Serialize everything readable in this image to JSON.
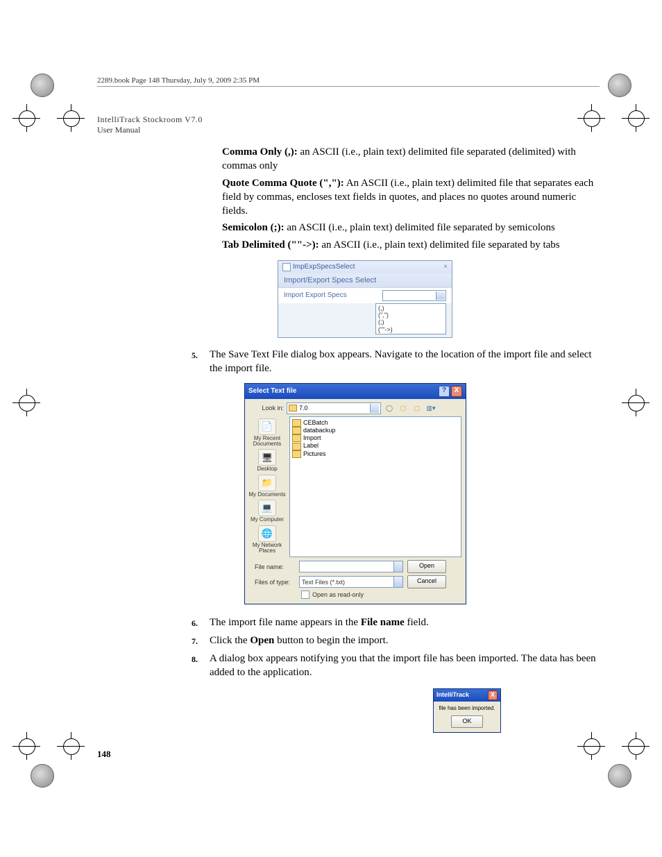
{
  "header": "2289.book  Page 148  Thursday, July 9, 2009  2:35 PM",
  "doc_title_caps": "IntelliTrack Stockroom V7.0",
  "doc_subtitle": "User Manual",
  "defs": {
    "comma_term": "Comma Only (,):",
    "comma_text": " an ASCII (i.e., plain text) delimited file separated (delimited) with commas only",
    "quote_term": "Quote Comma Quote (\",\"):",
    "quote_text": " An ASCII (i.e., plain text) delimited file that separates each field by commas, encloses text fields in quotes, and places no quotes around numeric fields.",
    "semi_term": "Semicolon (;):",
    "semi_text": " an ASCII (i.e., plain text) delimited file separated by semicolons",
    "tab_term": "Tab Delimited  (\"\"->):",
    "tab_text": " an ASCII (i.e., plain text) delimited file separated by tabs"
  },
  "fig1": {
    "window_title": "ImpExpSpecsSelect",
    "heading": "Import/Export Specs Select",
    "label": "Import Export Specs",
    "options": [
      "(,)",
      "(\",\")",
      "(;)",
      "(\"\"->)"
    ]
  },
  "steps": {
    "s5": "The Save Text File dialog box appears. Navigate to the location of the import file and select the import file.",
    "s6_a": "The import file name appears in the ",
    "s6_bold": "File name",
    "s6_b": " field.",
    "s7_a": "Click the ",
    "s7_bold": "Open",
    "s7_b": " button to begin the import.",
    "s8": "A dialog box appears notifying you that the import file has been imported. The data has been added to the application."
  },
  "fig2": {
    "title": "Select Text file",
    "lookin_label": "Look in:",
    "lookin_value": "7.0",
    "places": [
      "My Recent Documents",
      "Desktop",
      "My Documents",
      "My Computer",
      "My Network Places"
    ],
    "folders": [
      "CEBatch",
      "databackup",
      "Import",
      "Label",
      "Pictures"
    ],
    "filename_label": "File name:",
    "filename_value": "",
    "filetype_label": "Files of type:",
    "filetype_value": "Text Files (*.txt)",
    "readonly": "Open as read-only",
    "open": "Open",
    "cancel": "Cancel"
  },
  "fig3": {
    "title": "IntelliTrack",
    "msg": "file has been imported.",
    "ok": "OK"
  },
  "page_number": "148"
}
